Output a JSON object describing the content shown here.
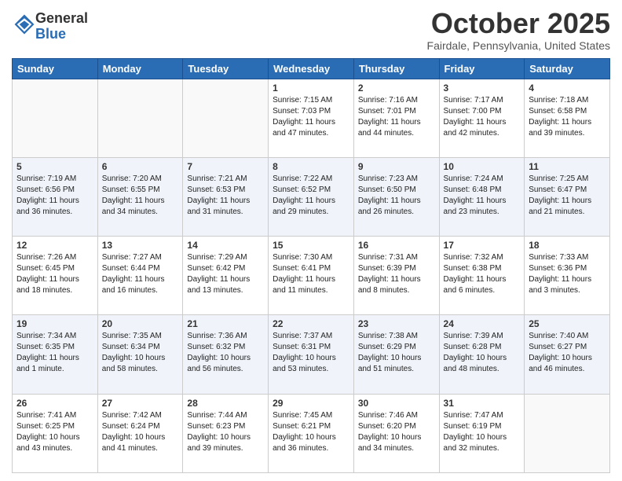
{
  "header": {
    "logo_general": "General",
    "logo_blue": "Blue",
    "month": "October 2025",
    "location": "Fairdale, Pennsylvania, United States"
  },
  "days_of_week": [
    "Sunday",
    "Monday",
    "Tuesday",
    "Wednesday",
    "Thursday",
    "Friday",
    "Saturday"
  ],
  "weeks": [
    [
      {
        "day": "",
        "content": ""
      },
      {
        "day": "",
        "content": ""
      },
      {
        "day": "",
        "content": ""
      },
      {
        "day": "1",
        "content": "Sunrise: 7:15 AM\nSunset: 7:03 PM\nDaylight: 11 hours\nand 47 minutes."
      },
      {
        "day": "2",
        "content": "Sunrise: 7:16 AM\nSunset: 7:01 PM\nDaylight: 11 hours\nand 44 minutes."
      },
      {
        "day": "3",
        "content": "Sunrise: 7:17 AM\nSunset: 7:00 PM\nDaylight: 11 hours\nand 42 minutes."
      },
      {
        "day": "4",
        "content": "Sunrise: 7:18 AM\nSunset: 6:58 PM\nDaylight: 11 hours\nand 39 minutes."
      }
    ],
    [
      {
        "day": "5",
        "content": "Sunrise: 7:19 AM\nSunset: 6:56 PM\nDaylight: 11 hours\nand 36 minutes."
      },
      {
        "day": "6",
        "content": "Sunrise: 7:20 AM\nSunset: 6:55 PM\nDaylight: 11 hours\nand 34 minutes."
      },
      {
        "day": "7",
        "content": "Sunrise: 7:21 AM\nSunset: 6:53 PM\nDaylight: 11 hours\nand 31 minutes."
      },
      {
        "day": "8",
        "content": "Sunrise: 7:22 AM\nSunset: 6:52 PM\nDaylight: 11 hours\nand 29 minutes."
      },
      {
        "day": "9",
        "content": "Sunrise: 7:23 AM\nSunset: 6:50 PM\nDaylight: 11 hours\nand 26 minutes."
      },
      {
        "day": "10",
        "content": "Sunrise: 7:24 AM\nSunset: 6:48 PM\nDaylight: 11 hours\nand 23 minutes."
      },
      {
        "day": "11",
        "content": "Sunrise: 7:25 AM\nSunset: 6:47 PM\nDaylight: 11 hours\nand 21 minutes."
      }
    ],
    [
      {
        "day": "12",
        "content": "Sunrise: 7:26 AM\nSunset: 6:45 PM\nDaylight: 11 hours\nand 18 minutes."
      },
      {
        "day": "13",
        "content": "Sunrise: 7:27 AM\nSunset: 6:44 PM\nDaylight: 11 hours\nand 16 minutes."
      },
      {
        "day": "14",
        "content": "Sunrise: 7:29 AM\nSunset: 6:42 PM\nDaylight: 11 hours\nand 13 minutes."
      },
      {
        "day": "15",
        "content": "Sunrise: 7:30 AM\nSunset: 6:41 PM\nDaylight: 11 hours\nand 11 minutes."
      },
      {
        "day": "16",
        "content": "Sunrise: 7:31 AM\nSunset: 6:39 PM\nDaylight: 11 hours\nand 8 minutes."
      },
      {
        "day": "17",
        "content": "Sunrise: 7:32 AM\nSunset: 6:38 PM\nDaylight: 11 hours\nand 6 minutes."
      },
      {
        "day": "18",
        "content": "Sunrise: 7:33 AM\nSunset: 6:36 PM\nDaylight: 11 hours\nand 3 minutes."
      }
    ],
    [
      {
        "day": "19",
        "content": "Sunrise: 7:34 AM\nSunset: 6:35 PM\nDaylight: 11 hours\nand 1 minute."
      },
      {
        "day": "20",
        "content": "Sunrise: 7:35 AM\nSunset: 6:34 PM\nDaylight: 10 hours\nand 58 minutes."
      },
      {
        "day": "21",
        "content": "Sunrise: 7:36 AM\nSunset: 6:32 PM\nDaylight: 10 hours\nand 56 minutes."
      },
      {
        "day": "22",
        "content": "Sunrise: 7:37 AM\nSunset: 6:31 PM\nDaylight: 10 hours\nand 53 minutes."
      },
      {
        "day": "23",
        "content": "Sunrise: 7:38 AM\nSunset: 6:29 PM\nDaylight: 10 hours\nand 51 minutes."
      },
      {
        "day": "24",
        "content": "Sunrise: 7:39 AM\nSunset: 6:28 PM\nDaylight: 10 hours\nand 48 minutes."
      },
      {
        "day": "25",
        "content": "Sunrise: 7:40 AM\nSunset: 6:27 PM\nDaylight: 10 hours\nand 46 minutes."
      }
    ],
    [
      {
        "day": "26",
        "content": "Sunrise: 7:41 AM\nSunset: 6:25 PM\nDaylight: 10 hours\nand 43 minutes."
      },
      {
        "day": "27",
        "content": "Sunrise: 7:42 AM\nSunset: 6:24 PM\nDaylight: 10 hours\nand 41 minutes."
      },
      {
        "day": "28",
        "content": "Sunrise: 7:44 AM\nSunset: 6:23 PM\nDaylight: 10 hours\nand 39 minutes."
      },
      {
        "day": "29",
        "content": "Sunrise: 7:45 AM\nSunset: 6:21 PM\nDaylight: 10 hours\nand 36 minutes."
      },
      {
        "day": "30",
        "content": "Sunrise: 7:46 AM\nSunset: 6:20 PM\nDaylight: 10 hours\nand 34 minutes."
      },
      {
        "day": "31",
        "content": "Sunrise: 7:47 AM\nSunset: 6:19 PM\nDaylight: 10 hours\nand 32 minutes."
      },
      {
        "day": "",
        "content": ""
      }
    ]
  ]
}
